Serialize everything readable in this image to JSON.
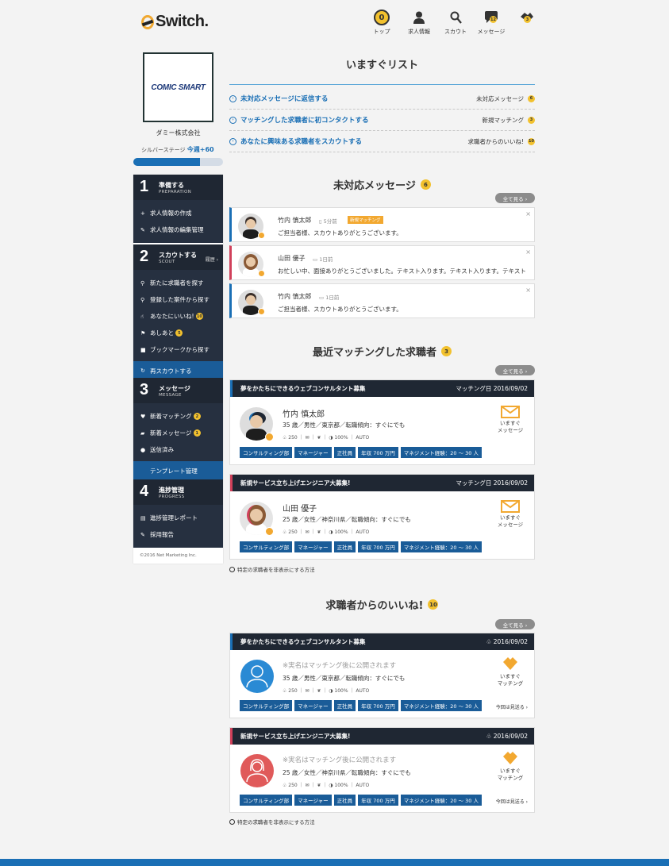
{
  "header": {
    "brand": "Switch.",
    "nav": [
      {
        "label": "トップ",
        "icon": "top-badge-icon",
        "badge": "0"
      },
      {
        "label": "求人情報",
        "icon": "person-icon"
      },
      {
        "label": "スカウト",
        "icon": "search-icon"
      },
      {
        "label": "メッセージ",
        "icon": "chat-icon",
        "badge": "12"
      },
      {
        "label": "",
        "icon": "handshake-icon",
        "badge": "3"
      }
    ]
  },
  "sidebar": {
    "company_logo_text": "COMIC SMART",
    "company_name": "ダミー株式会社",
    "stage_label": "シルバーステージ",
    "stage_value": "今週+60",
    "progress": 0.74,
    "sections": [
      {
        "num": "1",
        "title": "準備する",
        "sub": "PREPARATION",
        "right": "",
        "items": [
          {
            "icon": "+",
            "label": "求人情報の作成"
          },
          {
            "icon": "✎",
            "label": "求人情報の編集管理"
          }
        ]
      },
      {
        "num": "2",
        "title": "スカウトする",
        "sub": "SCOUT",
        "right": "履歴 ›",
        "items": [
          {
            "icon": "⚲",
            "label": "新たに求職者を探す"
          },
          {
            "icon": "⚲",
            "label": "登録した案件から探す"
          },
          {
            "icon": "☝",
            "label": "あなたにいいね!",
            "badge": "10"
          },
          {
            "icon": "⚑",
            "label": "あしあと",
            "badge": "5"
          },
          {
            "icon": "■",
            "label": "ブックマークから探す"
          },
          {
            "icon": "↻",
            "label": "再スカウトする",
            "active": true
          }
        ]
      },
      {
        "num": "3",
        "title": "メッセージ",
        "sub": "MESSAGE",
        "right": "",
        "items": [
          {
            "icon": "♥",
            "label": "新着マッチング",
            "badge": "2"
          },
          {
            "icon": "▰",
            "label": "新着メッセージ",
            "badge": "1"
          },
          {
            "icon": "●",
            "label": "送信済み"
          },
          {
            "icon": "",
            "label": "テンプレート管理",
            "active": true
          }
        ]
      },
      {
        "num": "4",
        "title": "進捗管理",
        "sub": "PROGRESS",
        "right": "",
        "items": [
          {
            "icon": "▤",
            "label": "進捗管理レポート"
          },
          {
            "icon": "✎",
            "label": "採用報告"
          }
        ]
      }
    ],
    "copyright": "©2016 Net Marketing Inc."
  },
  "todo": {
    "title": "いますぐリスト",
    "rows": [
      {
        "action": "未対応メッセージに返信する",
        "label": "未対応メッセージ",
        "badge": "6"
      },
      {
        "action": "マッチングした求職者に初コンタクトする",
        "label": "新規マッチング",
        "badge": "3"
      },
      {
        "action": "あなたに興味ある求職者をスカウトする",
        "label": "求職者からのいいね!",
        "badge": "10"
      }
    ]
  },
  "messages": {
    "title": "未対応メッセージ",
    "badge": "6",
    "more": "全て見る ›",
    "items": [
      {
        "name": "竹内 慎太郎",
        "time": "▯ 5分前",
        "tag": "新規マッチング",
        "text": "ご担当者様、スカウトありがとうございます。",
        "accent": "blue",
        "gender": "m"
      },
      {
        "name": "山田 優子",
        "time": "▭ 1日前",
        "tag": "",
        "text": "お忙しい中、面接ありがとうございました。テキスト入ります。テキスト入ります。テキスト入…",
        "accent": "red",
        "gender": "f"
      },
      {
        "name": "竹内 慎太郎",
        "time": "▭ 1日前",
        "tag": "",
        "text": "ご担当者様、スカウトありがとうございます。",
        "accent": "blue",
        "gender": "m"
      }
    ]
  },
  "matching": {
    "title": "最近マッチングした求職者",
    "badge": "3",
    "more": "全て見る ›",
    "cards": [
      {
        "job": "夢をかたちにできるウェブコンサルタント募集",
        "date": "マッチング日 2016/09/02",
        "name": "竹内 慎太郎",
        "info": "35 歳／男性／東京都／転職傾向：すぐにでも",
        "meta": "♧ 250 ｜ ✉ ｜ ❦ ｜ ◑ 100% ｜ AUTO",
        "tags": [
          "コンサルティング部",
          "マネージャー",
          "正社員",
          "年収 700 万円",
          "マネジメント経験：20 〜 30 人"
        ],
        "action": "いますぐ\nメッセージ",
        "accent": "blue",
        "gender": "m"
      },
      {
        "job": "新規サービス立ち上げエンジニア大募集!",
        "date": "マッチング日 2016/09/02",
        "name": "山田 優子",
        "info": "25 歳／女性／神奈川県／転職傾向：すぐにでも",
        "meta": "♧ 250 ｜ ✉ ｜ ❦ ｜ ◑ 100% ｜ AUTO",
        "tags": [
          "コンサルティング部",
          "マネージャー",
          "正社員",
          "年収 700 万円",
          "マネジメント経験：20 〜 30 人"
        ],
        "action": "いますぐ\nメッセージ",
        "accent": "red",
        "gender": "f"
      }
    ],
    "note": "特定の求職者を非表示にする方法"
  },
  "likes": {
    "title": "求職者からのいいね!",
    "badge": "10",
    "more": "全て見る ›",
    "cards": [
      {
        "job": "夢をかたちにできるウェブコンサルタント募集",
        "date": "♧ 2016/09/02",
        "name": "※実名はマッチング後に公開されます",
        "info": "35 歳／男性／東京都／転職傾向：すぐにでも",
        "meta": "♧ 250 ｜ ✉ ｜ ❦ ｜ ◑ 100% ｜ AUTO",
        "tags": [
          "コンサルティング部",
          "マネージャー",
          "正社員",
          "年収 700 万円",
          "マネジメント経験：20 〜 30 人"
        ],
        "action": "いますぐ\nマッチング",
        "next": "今回は見送る ›",
        "accent": "blue",
        "color": "#2a8ad4"
      },
      {
        "job": "新規サービス立ち上げエンジニア大募集!",
        "date": "♧ 2016/09/02",
        "name": "※実名はマッチング後に公開されます",
        "info": "25 歳／女性／神奈川県／転職傾向：すぐにでも",
        "meta": "♧ 250 ｜ ✉ ｜ ❦ ｜ ◑ 100% ｜ AUTO",
        "tags": [
          "コンサルティング部",
          "マネージャー",
          "正社員",
          "年収 700 万円",
          "マネジメント経験：20 〜 30 人"
        ],
        "action": "いますぐ\nマッチング",
        "next": "今回は見送る ›",
        "accent": "red",
        "color": "#e05a5a"
      }
    ],
    "note": "特定の求職者を非表示にする方法"
  }
}
